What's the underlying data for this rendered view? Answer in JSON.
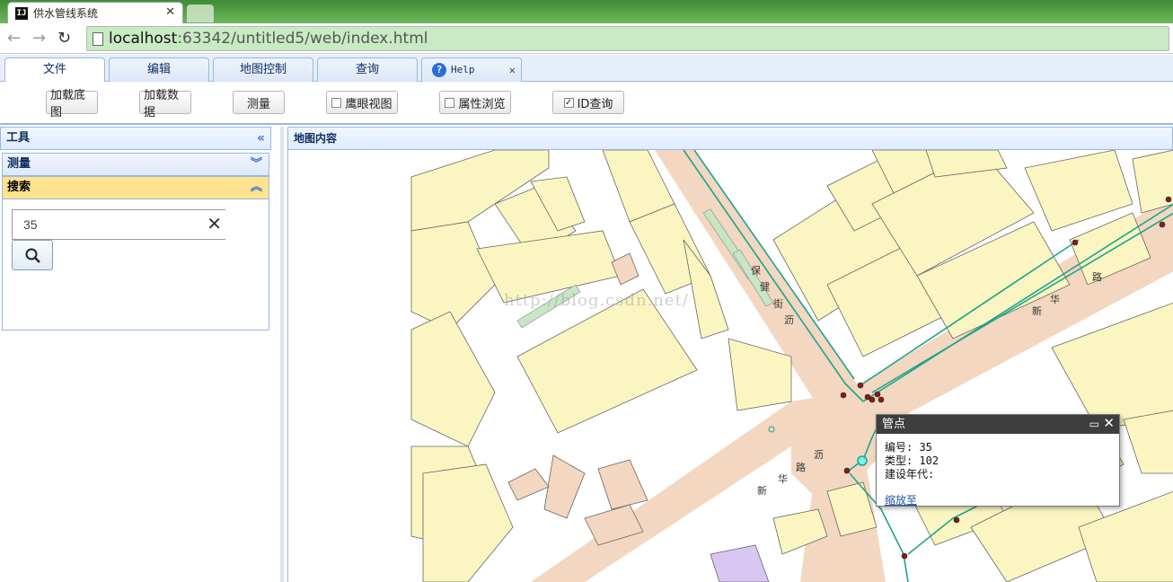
{
  "browser": {
    "tab_title": "供水管线系统",
    "url_host": "localhost",
    "url_rest": ":63342/untitled5/web/index.html"
  },
  "top_tabs": [
    "文件",
    "编辑",
    "地图控制",
    "查询"
  ],
  "help_tab": "Help",
  "ribbon": {
    "load_basemap": "加载底图",
    "load_data": "加载数据",
    "measure": "测量",
    "eagle_view": "鹰眼视图",
    "attr_browse": "属性浏览",
    "id_query": "ID查询"
  },
  "left": {
    "panel_title": "工具",
    "measure_section": "测量",
    "search_section": "搜索",
    "search_value": "35"
  },
  "map": {
    "panel_title": "地图内容",
    "watermark": "http://blog.csdn.net/",
    "street_labels": [
      "保",
      "健",
      "街",
      "沥",
      "华",
      "路",
      "新",
      "沥",
      "华",
      "路",
      "新"
    ],
    "popup": {
      "title": "管点",
      "line1": "编号: 35",
      "line2": "类型: 102",
      "line3": "建设年代:",
      "zoom_link": "缩放至"
    }
  },
  "colors": {
    "building": "#fbf6c1",
    "road": "#f3d7c0",
    "pipe": "#1aa58c",
    "node": "#8b1a1a",
    "accent": "#95b8e7"
  }
}
